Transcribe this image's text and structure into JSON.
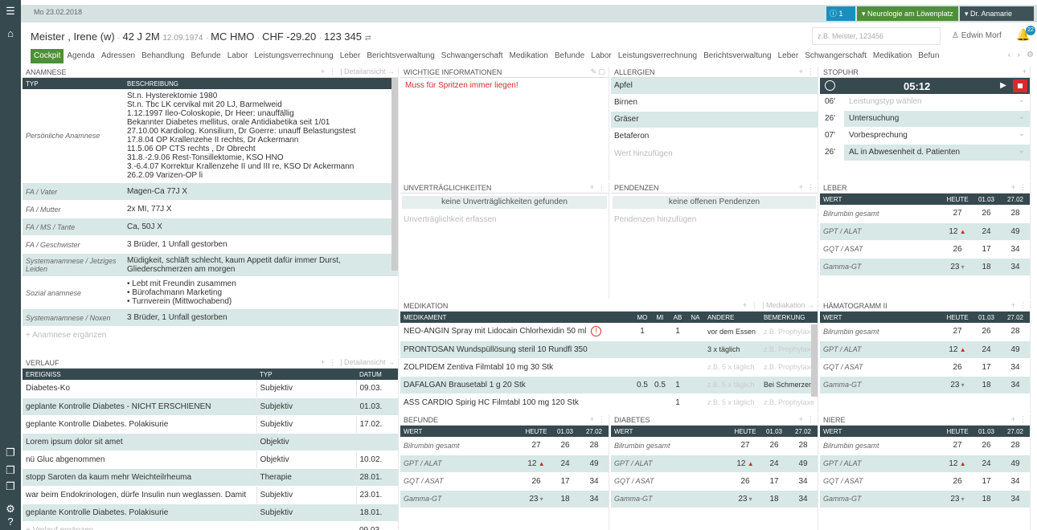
{
  "topbar": {
    "date": "Mo 23.02.2018",
    "info_count": "1",
    "context1": "Neurologie am Löwenplatz",
    "context2": "Dr. Anamarie Meier"
  },
  "patient": {
    "name": "Meister , Irene (w)",
    "age": "42 J 2M",
    "dob": "12.09.1974",
    "insurance": "MC HMO",
    "balance": "CHF -29.20",
    "number": "123 345"
  },
  "search": {
    "placeholder": "z.B. Meister, 123456"
  },
  "user": {
    "name": "Edwin Morf",
    "badge": "22"
  },
  "tabs": [
    "Cockpit",
    "Agenda",
    "Adressen",
    "Behandlung",
    "Befunde",
    "Labor",
    "Leistungsverrechnung",
    "Leber",
    "Berichtsverwaltung",
    "Schwangerschaft",
    "Medikation",
    "Befunde",
    "Labor",
    "Leistungsverrechnung",
    "Berichtsverwaltung",
    "Leber",
    "Schwangerschaft",
    "Medikation",
    "Befun"
  ],
  "anamnese": {
    "title": "ANAMNESE",
    "detail": "Detailansicht",
    "col_typ": "TYP",
    "col_desc": "BESCHREIBUNG",
    "rows": [
      {
        "typ": "Persönliche Anamnese",
        "desc": [
          "St.n. Hysterektomie 1980",
          "St.n. Tbc LK cervikal mit 20 LJ, Barmelweid",
          "1.12.1997 Ileo-Coloskopie, Dr Heer: unauffällig",
          "Bekannter Diabetes mellitus, orale Antidiabetika seit 1/01",
          "27.10.00 Kardiolog. Konsilium, Dr Goerre: unauff Belastungstest",
          "17.8.04 OP Krallenzehe II rechts, Dr Ackermann",
          "11.5.06 OP CTS rechts , Dr Obrecht",
          "31.8.-2.9.06 Rest-Tonsillektomie, KSO HNO",
          "3.-6.4.07 Korrektur Krallenzehe II und III re, KSO Dr Ackermann",
          "26.2.09 Varizen-OP li"
        ]
      },
      {
        "typ": "FA / Vater",
        "desc": [
          "Magen-Ca 77J X"
        ]
      },
      {
        "typ": "FA / Mutter",
        "desc": [
          "2x MI, 77J X"
        ]
      },
      {
        "typ": "FA / MS / Tante",
        "desc": [
          "Ca, 50J X"
        ]
      },
      {
        "typ": "FA / Geschwister",
        "desc": [
          "3 Brüder, 1 Unfall gestorben"
        ]
      },
      {
        "typ": "Systemanamnese / Jetziges Leiden",
        "desc": [
          "Müdigkeit, schläft schlecht, kaum Appetit dafür immer Durst,",
          "Gliederschmerzen am morgen"
        ]
      },
      {
        "typ": "Sozial anamnese",
        "desc": [
          "• Lebt mit Freundin zusammen",
          "• Bürofachmann Marketing",
          "• Turnverein (Mittwochabend)"
        ]
      },
      {
        "typ": "Systemanamnese / Noxen",
        "desc": [
          "3 Brüder, 1 Unfall gestorben"
        ]
      }
    ],
    "add": "+ Anamnese ergänzen"
  },
  "verlauf": {
    "title": "VERLAUF",
    "detail": "Detailansicht",
    "cols": [
      "EREIGNISS",
      "TYP",
      "DATUM"
    ],
    "rows": [
      [
        "Diabetes-Ko",
        "Subjektiv",
        "09.03."
      ],
      [
        "geplante Kontrolle Diabetes - NICHT ERSCHIENEN",
        "Subjektiv",
        "01.03."
      ],
      [
        "geplante Kontrolle Diabetes. Polakisurie",
        "Subjektiv",
        "17.02."
      ],
      [
        "Lorem ipsum dolor sit amet",
        "Objektiv",
        ""
      ],
      [
        "nü Gluc abgenommen",
        "Objektiv",
        "10.02."
      ],
      [
        "stopp Saroten da kaum mehr Weichteilrheuma",
        "Therapie",
        "28.01."
      ],
      [
        "war beim Endokrinologen, dürfe Insulin nun weglassen. Damit",
        "Subjektiv",
        "23.01."
      ],
      [
        "geplante Kontrolle Diabetes. Polakisurie",
        "Subjektiv",
        "18.01."
      ]
    ],
    "add": "+ Verlauf ergänzen",
    "add_date": "09.03."
  },
  "wichtig": {
    "title": "WICHTIGE INFORMATIONEN",
    "text": "Muss für Spritzen immer liegen!"
  },
  "allergien": {
    "title": "ALLERGIEN",
    "items": [
      "Apfel",
      "Birnen",
      "Gräser",
      "Betaferon"
    ],
    "placeholder": "Wert hinzufügen"
  },
  "stopuhr": {
    "title": "STOPUHR",
    "time": "05:12",
    "rows": [
      {
        "m": "06'",
        "d": "Leistungstyp wählen",
        "ph": true
      },
      {
        "m": "26'",
        "d": "Untersuchung"
      },
      {
        "m": "07'",
        "d": "Vorbesprechung"
      },
      {
        "m": "26'",
        "d": "AL in Abwesenheit d. Patienten"
      }
    ]
  },
  "unvertr": {
    "title": "UNVERTRÄGLICHKEITEN",
    "btn": "keine Unverträglichkeiten gefunden",
    "placeholder": "Unverträglichkeit erfassen"
  },
  "pendenzen": {
    "title": "PENDENZEN",
    "btn": "keine offenen Pendenzen",
    "placeholder": "Pendenzen hinzufügen"
  },
  "medikation": {
    "title": "MEDIKATION",
    "detail": "Mediakation",
    "cols": [
      "MEDIKAMENT",
      "MO",
      "MI",
      "AB",
      "NA",
      "ANDERE",
      "BEMERKUNG"
    ],
    "rows": [
      [
        "NEO-ANGIN Spray mit Lidocain Chlorhexidin 50 ml",
        "1",
        "",
        "1",
        "",
        "vor dem Essen",
        "z.B. Prophylaxe"
      ],
      [
        "PRONTOSAN Wundspüllösung steril 10 Rundfl 350",
        "",
        "",
        "",
        "",
        "3 x täglich",
        "z.B. Prophylaxe"
      ],
      [
        "ZOLPIDEM Zentiva Filmtabl 10 mg 30 Stk",
        "",
        "",
        "",
        "",
        "z.B. 5 x täglich",
        "z.B. Prophylaxe"
      ],
      [
        "DAFALGAN Brausetabl 1 g 20 Stk",
        "0.5",
        "0.5",
        "1",
        "",
        "z.B. 5 x täglich",
        "Bei Schmerzen"
      ],
      [
        "ASS CARDIO Spirig HC Filmtabl 100 mg 120 Stk",
        "",
        "",
        "1",
        "",
        "z.B. 5 x täglich",
        "z.B. Prophylaxe"
      ]
    ]
  },
  "labcols": [
    "WERT",
    "HEUTE",
    "01.03",
    "27.02"
  ],
  "labrows": [
    [
      "Bilrumbin gesamt",
      "27",
      "",
      "26",
      "28"
    ],
    [
      "GPT / ALAT",
      "12",
      "up",
      "24",
      "49"
    ],
    [
      "GQT / ASAT",
      "26",
      "",
      "17",
      "34"
    ],
    [
      "Gamma-GT",
      "23",
      "down",
      "18",
      "34"
    ]
  ],
  "leber": {
    "title": "LEBER"
  },
  "haema": {
    "title": "HÄMATOGRAMM II"
  },
  "befunde": {
    "title": "BEFUNDE"
  },
  "diabetes": {
    "title": "DIABETES"
  },
  "niere": {
    "title": "NIERE"
  }
}
